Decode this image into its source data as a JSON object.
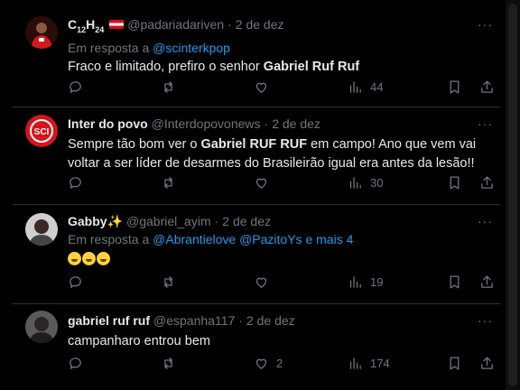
{
  "tweets": [
    {
      "name_main": "C",
      "name_sub1": "12",
      "name_mid": "H",
      "name_sub2": "24",
      "handle": "@padariadariven",
      "dot": "·",
      "date": "2 de dez",
      "reply_prefix": "Em resposta a",
      "reply_to": "@scinterkpop",
      "text_plain": "Fraco e limitado, prefiro o senhor ",
      "text_bold": "Gabriel Ruf Ruf",
      "views": "44",
      "avatar_icon": "player-red-jersey-avatar",
      "flag_icon": "austria-flag-icon"
    },
    {
      "name": "Inter do povo",
      "handle": "@Interdopovonews",
      "dot": "·",
      "date": "2 de dez",
      "text_1": "Sempre tão bom ver o ",
      "text_bold": "Gabriel RUF RUF",
      "text_2": " em campo! Ano que vem vai voltar a ser líder de desarmes do Brasileirão igual era antes da lesão!!",
      "views": "30",
      "avatar_icon": "internacional-crest-avatar"
    },
    {
      "name": "Gabby",
      "name_emoji": "✨",
      "handle": "@gabriel_ayim",
      "dot": "·",
      "date": "2 de dez",
      "reply_prefix": "Em resposta a",
      "reply_to_1": "@Abrantielove",
      "reply_to_2": "@PazitoYs",
      "reply_more": "e mais 4",
      "views": "19",
      "emoji_icon": "rolling-laughing-emoji"
    },
    {
      "name": "gabriel ruf ruf",
      "handle": "@espanha117",
      "dot": "·",
      "date": "2 de dez",
      "text": "campanharo entrou bem",
      "likes": "2",
      "views": "174"
    }
  ],
  "more_label": "···",
  "colors": {
    "background": "#000000",
    "text": "#e7e9ea",
    "muted": "#71767b",
    "link": "#1d9bf0",
    "divider": "#2f3336"
  }
}
